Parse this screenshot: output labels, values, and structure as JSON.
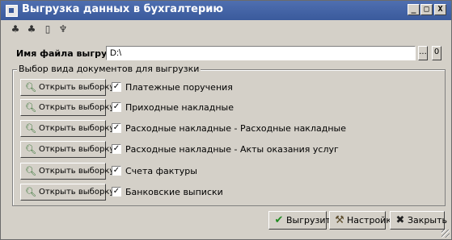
{
  "window": {
    "title": "Выгрузка данных в бухгалтерию",
    "controls": [
      "_",
      "□",
      "X"
    ]
  },
  "toolbar": {
    "icons": [
      "export-icon",
      "import-icon",
      "document-icon",
      "settings-icon"
    ]
  },
  "file": {
    "label": "Имя файла выгрузки:",
    "value": "D:\\",
    "browse_label": "...",
    "extra_label": "0"
  },
  "group": {
    "title": "Выбор вида документов для выгрузки",
    "rows": [
      {
        "button": "Открыть выборку",
        "checked": true,
        "label": "Платежные поручения"
      },
      {
        "button": "Открыть выборку",
        "checked": true,
        "label": "Приходные накладные"
      },
      {
        "button": "Открыть выборку",
        "checked": true,
        "label": "Расходные накладные - Расходные накладные"
      },
      {
        "button": "Открыть выборку",
        "checked": true,
        "label": "Расходные накладные - Акты оказания услуг"
      },
      {
        "button": "Открыть выборку",
        "checked": true,
        "label": "Счета фактуры"
      },
      {
        "button": "Открыть выборку",
        "checked": true,
        "label": "Банковские выписки"
      }
    ]
  },
  "actions": {
    "export": "Выгрузить",
    "settings": "Настройка",
    "close": "Закрыть"
  }
}
